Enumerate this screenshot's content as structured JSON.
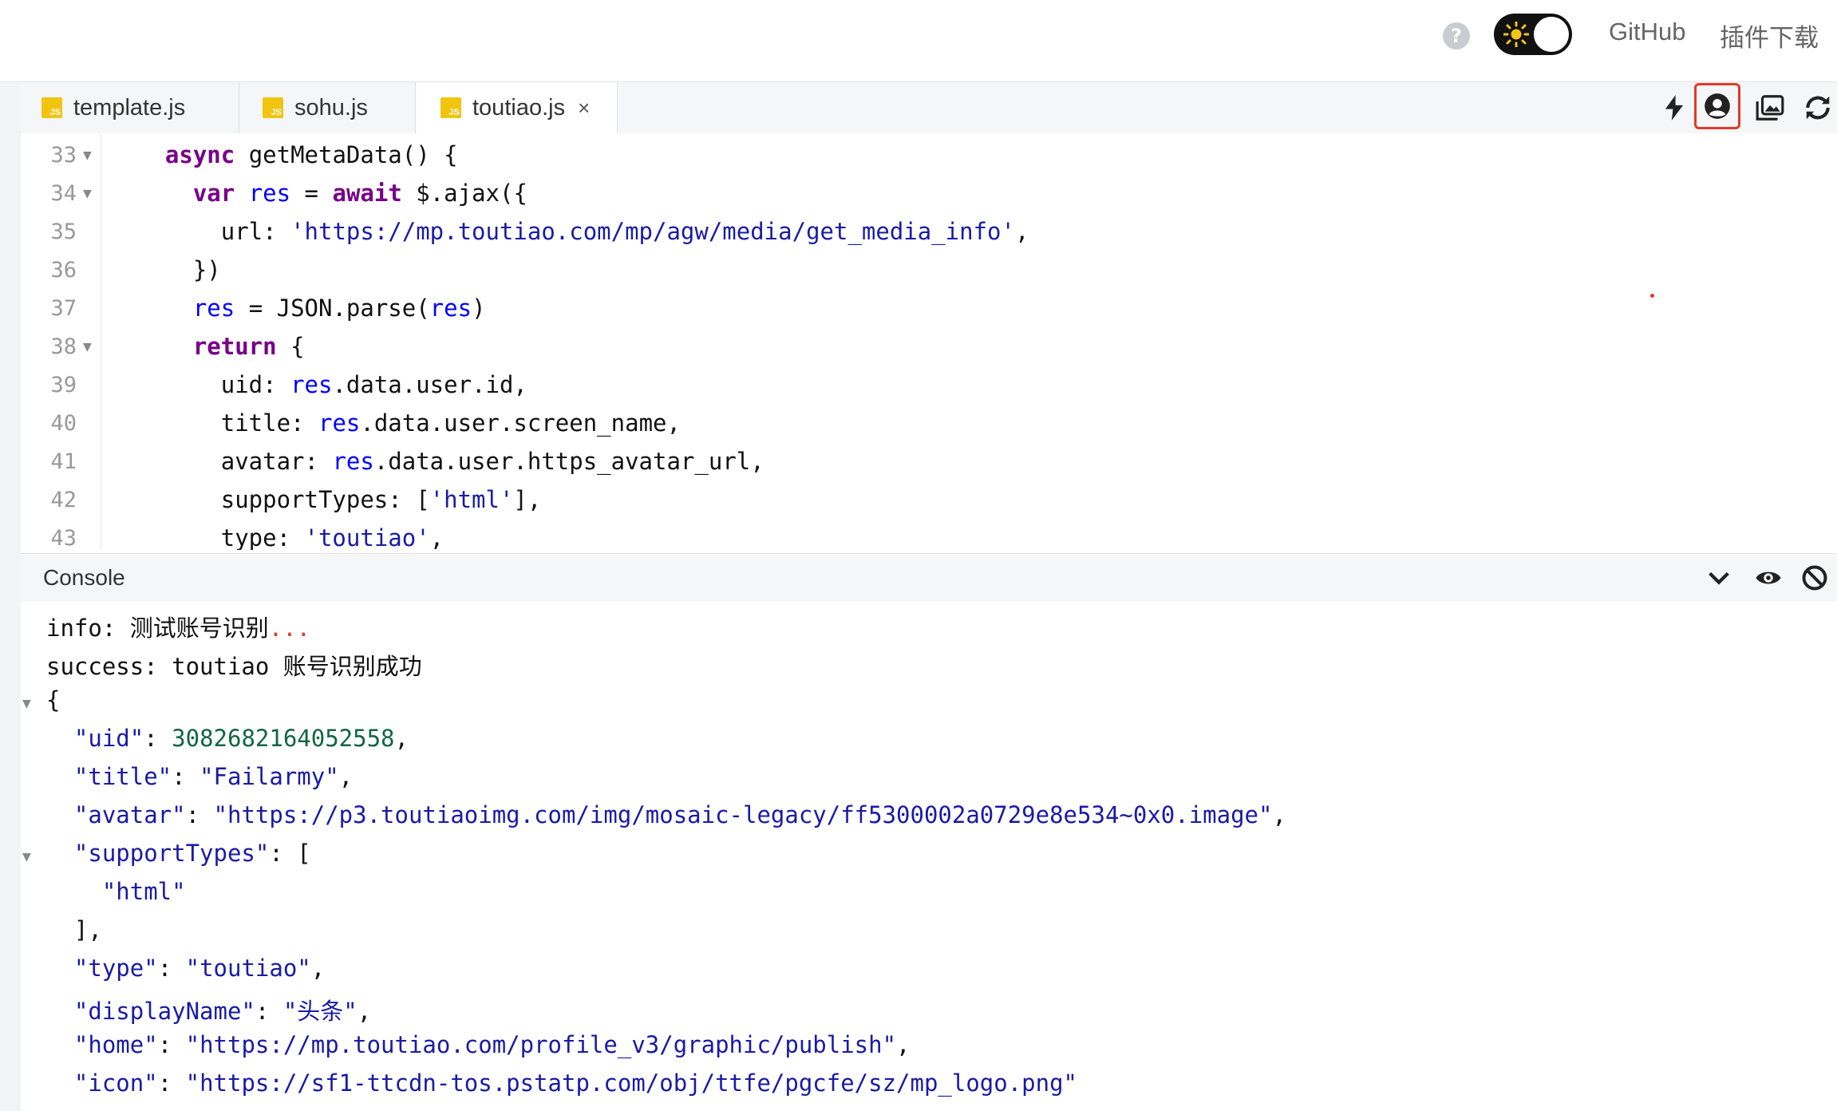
{
  "header": {
    "help_icon": "question-circle-icon",
    "theme_toggle_icon": "sun-icon",
    "github_label": "GitHub",
    "plugin_download_label": "插件下载"
  },
  "tabs": [
    {
      "label": "template.js",
      "icon": "js-file-icon",
      "active": false
    },
    {
      "label": "sohu.js",
      "icon": "js-file-icon",
      "active": false
    },
    {
      "label": "toutiao.js",
      "icon": "js-file-icon",
      "active": true,
      "close": "×"
    }
  ],
  "toolbar": {
    "icons": [
      "lightning-icon",
      "account-circle-icon",
      "images-icon",
      "refresh-icon"
    ],
    "highlighted": "account-circle-icon",
    "highlight_color": "#e0392b"
  },
  "editor": {
    "lines": [
      {
        "number": "33",
        "fold": "▼",
        "text": "  async getMetaData() {"
      },
      {
        "number": "34",
        "fold": "▼",
        "text": "    var res = await $.ajax({"
      },
      {
        "number": "35",
        "fold": "",
        "text": "      url: 'https://mp.toutiao.com/mp/agw/media/get_media_info',"
      },
      {
        "number": "36",
        "fold": "",
        "text": "    })"
      },
      {
        "number": "37",
        "fold": "",
        "text": "    res = JSON.parse(res)"
      },
      {
        "number": "38",
        "fold": "▼",
        "text": "    return {"
      },
      {
        "number": "39",
        "fold": "",
        "text": "      uid: res.data.user.id,"
      },
      {
        "number": "40",
        "fold": "",
        "text": "      title: res.data.user.screen_name,"
      },
      {
        "number": "41",
        "fold": "",
        "text": "      avatar: res.data.user.https_avatar_url,"
      },
      {
        "number": "42",
        "fold": "",
        "text": "      supportTypes: ['html'],"
      },
      {
        "number": "43",
        "fold": "",
        "text": "      type: 'toutiao',"
      }
    ]
  },
  "console": {
    "title": "Console",
    "tool_icons": [
      "chevron-down-icon",
      "eye-icon",
      "block-icon"
    ],
    "lines": [
      {
        "text": "info: 测试账号识别...",
        "fold": ""
      },
      {
        "text": "success: toutiao 账号识别成功",
        "fold": ""
      },
      {
        "text": "{",
        "fold": "▼"
      },
      {
        "text": "  \"uid\": 3082682164052558,",
        "fold": ""
      },
      {
        "text": "  \"title\": \"Failarmy\",",
        "fold": ""
      },
      {
        "text": "  \"avatar\": \"https://p3.toutiaoimg.com/img/mosaic-legacy/ff5300002a0729e8e534~0x0.image\",",
        "fold": ""
      },
      {
        "text": "  \"supportTypes\": [",
        "fold": "▼"
      },
      {
        "text": "    \"html\"",
        "fold": ""
      },
      {
        "text": "  ],",
        "fold": ""
      },
      {
        "text": "  \"type\": \"toutiao\",",
        "fold": ""
      },
      {
        "text": "  \"displayName\": \"头条\",",
        "fold": ""
      },
      {
        "text": "  \"home\": \"https://mp.toutiao.com/profile_v3/graphic/publish\",",
        "fold": ""
      },
      {
        "text": "  \"icon\": \"https://sf1-ttcdn-tos.pstatp.com/obj/ttfe/pgcfe/sz/mp_logo.png\"",
        "fold": ""
      }
    ]
  }
}
